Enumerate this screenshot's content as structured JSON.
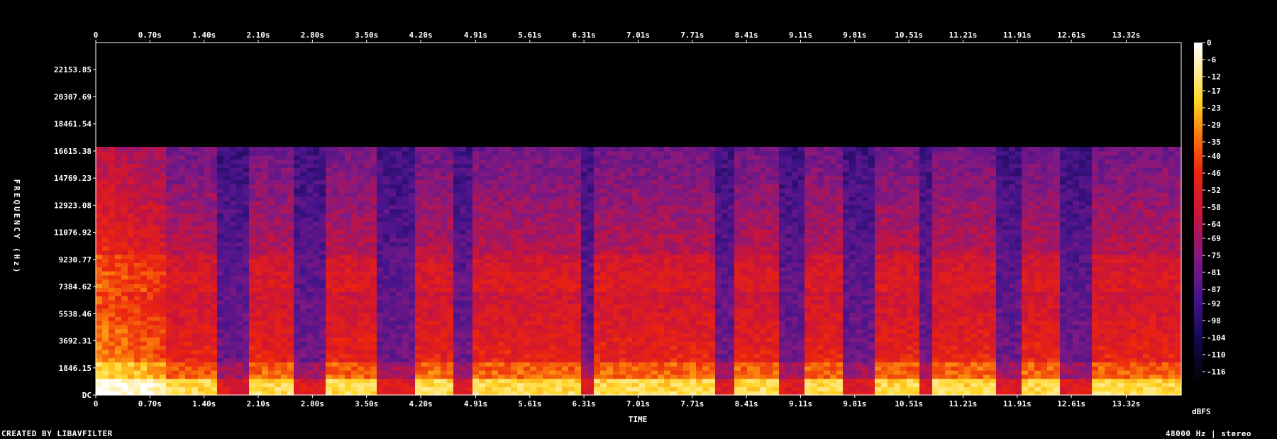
{
  "chart_data": {
    "type": "heatmap",
    "subtype": "spectrogram",
    "xlabel": "TIME",
    "ylabel": "FREQUENCY (Hz)",
    "colorbar_label": "dBFS",
    "x_ticks": [
      "0",
      "0.70s",
      "1.40s",
      "2.10s",
      "2.80s",
      "3.50s",
      "4.20s",
      "4.91s",
      "5.61s",
      "6.31s",
      "7.01s",
      "7.71s",
      "8.41s",
      "9.11s",
      "9.81s",
      "10.51s",
      "11.21s",
      "11.91s",
      "12.61s",
      "13.32s"
    ],
    "x_tick_values": [
      0,
      0.7,
      1.4,
      2.1,
      2.8,
      3.5,
      4.2,
      4.91,
      5.61,
      6.31,
      7.01,
      7.71,
      8.41,
      9.11,
      9.81,
      10.51,
      11.21,
      11.91,
      12.61,
      13.32
    ],
    "xlim": [
      0,
      14.03
    ],
    "y_ticks": [
      "DC",
      "1846.15",
      "3692.31",
      "5538.46",
      "7384.62",
      "9230.77",
      "11076.92",
      "12923.08",
      "14769.23",
      "16615.38",
      "18461.54",
      "20307.69",
      "22153.85"
    ],
    "y_tick_values": [
      0,
      1846.15,
      3692.31,
      5538.46,
      7384.62,
      9230.77,
      11076.92,
      12923.08,
      14769.23,
      16615.38,
      18461.54,
      20307.69,
      22153.85
    ],
    "ylim": [
      0,
      24000
    ],
    "cutoff_frequency_hz": 16900,
    "colorbar_ticks": [
      "0",
      "-6",
      "-12",
      "-17",
      "-23",
      "-29",
      "-35",
      "-40",
      "-46",
      "-52",
      "-58",
      "-64",
      "-69",
      "-75",
      "-81",
      "-87",
      "-92",
      "-98",
      "-104",
      "-110",
      "-116"
    ],
    "colorbar_values": [
      0,
      -6,
      -12,
      -17,
      -23,
      -29,
      -35,
      -40,
      -46,
      -52,
      -58,
      -64,
      -69,
      -75,
      -81,
      -87,
      -92,
      -98,
      -104,
      -110,
      -116
    ],
    "colorbar_range": [
      -120,
      0
    ],
    "colors": {
      "background": "#000000",
      "high": "#ffffff",
      "mid_high": "#ffcc00",
      "mid": "#e0200f",
      "low": "#5a1a9a",
      "lowest": "#000000"
    },
    "loud_segments_s": [
      [
        0,
        1.5
      ],
      [
        1.9,
        2.5
      ],
      [
        2.9,
        3.6
      ],
      [
        4.1,
        4.6
      ],
      [
        4.8,
        6.2
      ],
      [
        6.4,
        8.0
      ],
      [
        8.2,
        8.8
      ],
      [
        9.1,
        9.6
      ],
      [
        10.0,
        10.6
      ],
      [
        10.8,
        11.6
      ],
      [
        11.9,
        12.4
      ],
      [
        12.8,
        14.0
      ]
    ]
  },
  "footer": {
    "left": "CREATED BY LIBAVFILTER",
    "right": "48000 Hz | stereo"
  }
}
